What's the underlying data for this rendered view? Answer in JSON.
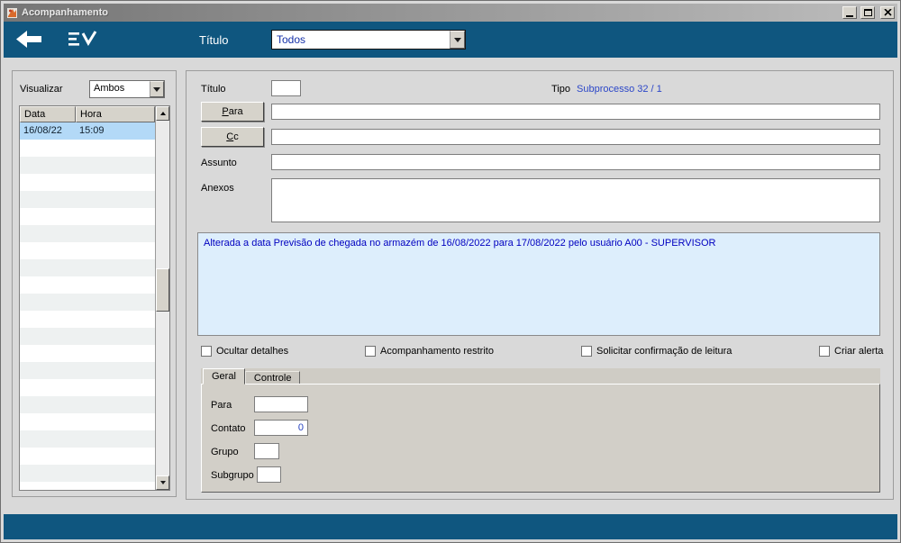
{
  "window": {
    "title": "Acompanhamento"
  },
  "toolbar": {
    "title_label": "Título",
    "filter_value": "Todos"
  },
  "left_panel": {
    "visualizar_label": "Visualizar",
    "visualizar_value": "Ambos",
    "table": {
      "columns": [
        "Data",
        "Hora"
      ],
      "rows": [
        {
          "data": "16/08/22",
          "hora": "15:09"
        }
      ],
      "selected_row_index": 0,
      "empty_rows": 21
    }
  },
  "form": {
    "titulo_label": "Título",
    "titulo_value": "",
    "tipo_label": "Tipo",
    "tipo_value": "Subprocesso 32 / 1",
    "para_button": {
      "mnemonic": "P",
      "rest": "ara"
    },
    "para_value": "",
    "cc_button": {
      "mnemonic": "C",
      "rest": "c"
    },
    "cc_value": "",
    "assunto_label": "Assunto",
    "assunto_value": "",
    "anexos_label": "Anexos",
    "anexos_value": "",
    "message_text": "Alterada a data Previsão de chegada no armazém de 16/08/2022 para 17/08/2022 pelo usuário A00 - SUPERVISOR",
    "checkboxes": [
      {
        "label": "Ocultar detalhes",
        "checked": false
      },
      {
        "label": "Acompanhamento restrito",
        "checked": false
      },
      {
        "label": "Solicitar confirmação de leitura",
        "checked": false
      },
      {
        "label": "Criar alerta",
        "checked": false
      }
    ],
    "tabs": [
      {
        "label": "Geral",
        "active": true
      },
      {
        "label": "Controle",
        "active": false
      }
    ],
    "tab_geral": {
      "para_label": "Para",
      "para_value": "",
      "contato_label": "Contato",
      "contato_value": "0",
      "grupo_label": "Grupo",
      "grupo_value": "",
      "subgrupo_label": "Subgrupo",
      "subgrupo_value": ""
    }
  },
  "colors": {
    "toolbar_bg": "#0f567f",
    "message_bg": "#ddeefc",
    "message_text": "#0000c0",
    "link_blue": "#2c47c8",
    "selection_bg": "#b3d9f7"
  }
}
